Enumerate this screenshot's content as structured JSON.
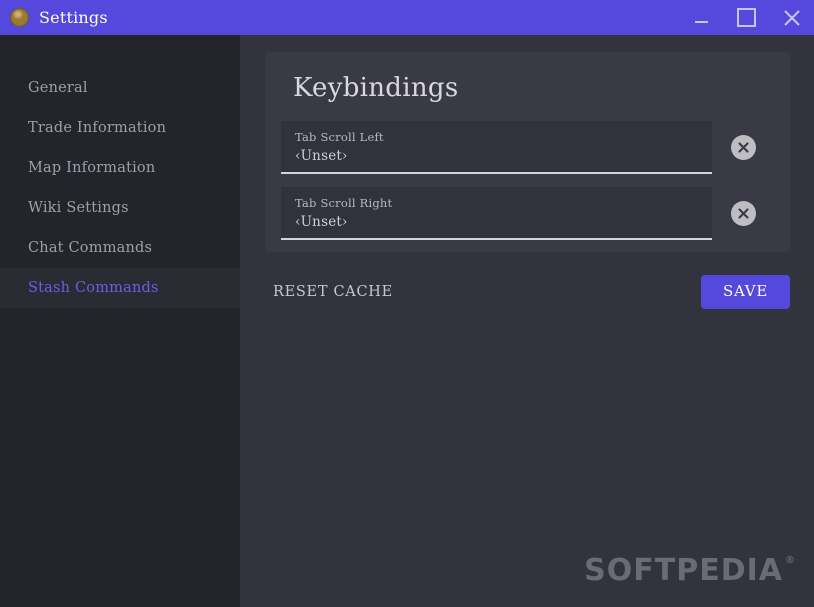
{
  "window": {
    "title": "Settings",
    "icon": "app-orb-icon",
    "controls": {
      "minimize": "minimize-icon",
      "maximize": "maximize-icon",
      "close": "close-icon"
    },
    "titlebar_color": "#5548dd"
  },
  "sidebar": {
    "items": [
      {
        "label": "General",
        "active": false
      },
      {
        "label": "Trade Information",
        "active": false
      },
      {
        "label": "Map Information",
        "active": false
      },
      {
        "label": "Wiki Settings",
        "active": false
      },
      {
        "label": "Chat Commands",
        "active": false
      },
      {
        "label": "Stash Commands",
        "active": true
      }
    ],
    "active_color": "#6c5ce8",
    "background": "#24242c"
  },
  "main": {
    "card": {
      "title": "Keybindings",
      "fields": [
        {
          "label": "Tab Scroll Left",
          "value": "‹Unset›",
          "clear_icon": "clear-circle-x-icon"
        },
        {
          "label": "Tab Scroll Right",
          "value": "‹Unset›",
          "clear_icon": "clear-circle-x-icon"
        }
      ]
    },
    "actions": {
      "reset_label": "RESET CACHE",
      "save_label": "SAVE",
      "save_color": "#5548dd"
    }
  },
  "watermark": {
    "text": "SOFTPEDIA",
    "mark": "®"
  }
}
